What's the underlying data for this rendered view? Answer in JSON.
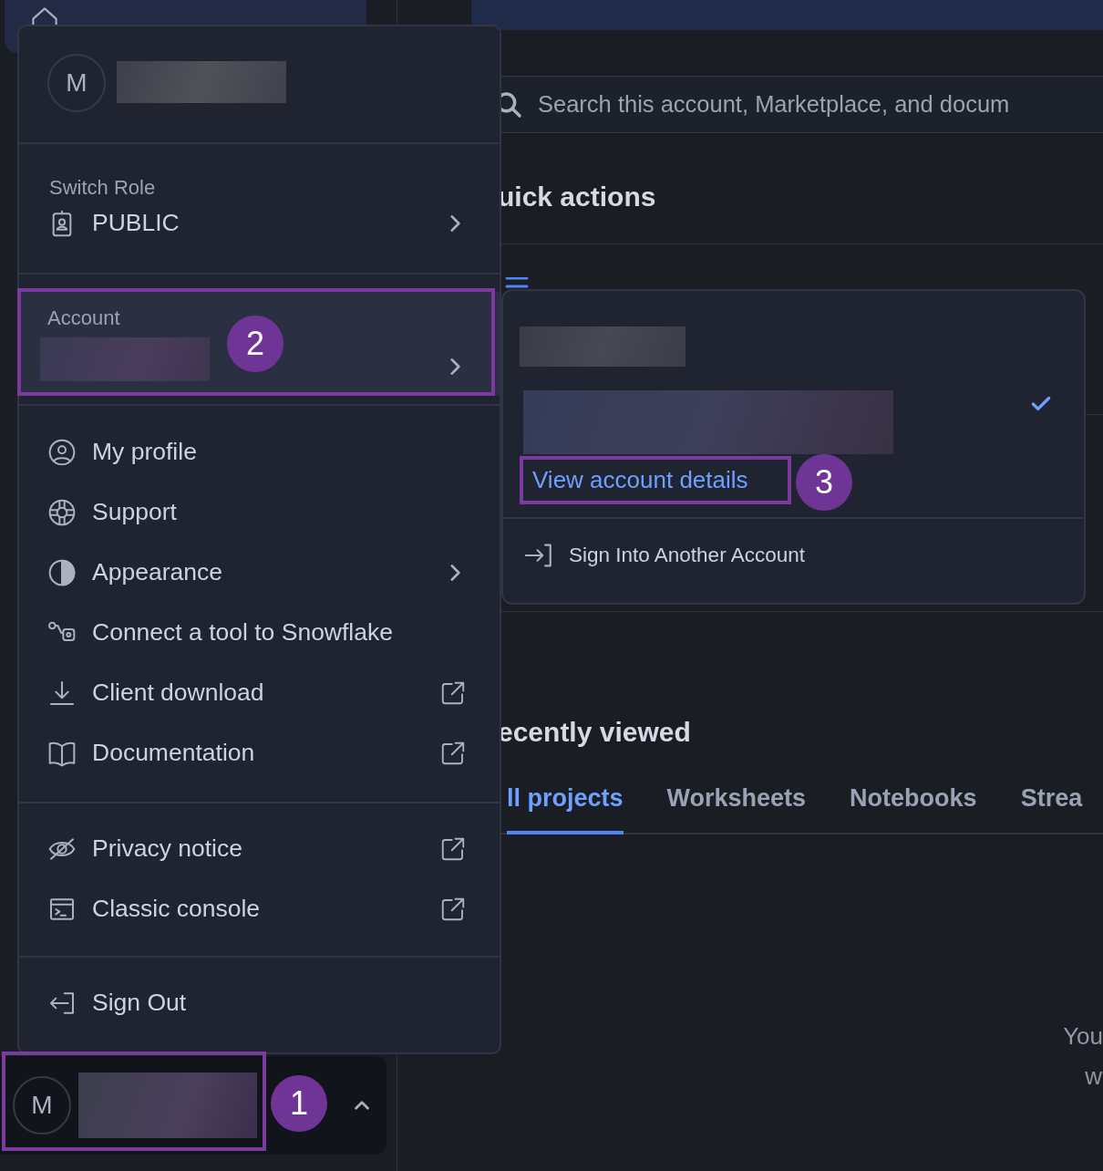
{
  "sidebar": {
    "home": {
      "selected": true
    },
    "user_button": {
      "avatar": "M",
      "expanded": true
    }
  },
  "search": {
    "placeholder": "Search this account, Marketplace, and docum"
  },
  "quick_actions": {
    "heading": "uick actions"
  },
  "recently_viewed": {
    "heading": "ecently viewed",
    "tabs": [
      {
        "label": "ll projects",
        "selected": true
      },
      {
        "label": "Worksheets",
        "selected": false
      },
      {
        "label": "Notebooks",
        "selected": false
      },
      {
        "label": "Strea",
        "selected": false
      }
    ],
    "empty_text": [
      "You",
      "w"
    ]
  },
  "user_menu": {
    "avatar": "M",
    "role": {
      "label": "Switch Role",
      "value": "PUBLIC"
    },
    "account": {
      "label": "Account",
      "selected": true
    },
    "groups": [
      [
        {
          "label": "My profile",
          "submenu": false,
          "external": false
        },
        {
          "label": "Support",
          "submenu": false,
          "external": false
        },
        {
          "label": "Appearance",
          "submenu": true,
          "external": false
        },
        {
          "label": "Connect a tool to Snowflake",
          "submenu": false,
          "external": false
        },
        {
          "label": "Client download",
          "submenu": false,
          "external": true
        },
        {
          "label": "Documentation",
          "submenu": false,
          "external": true
        }
      ],
      [
        {
          "label": "Privacy notice",
          "submenu": false,
          "external": true
        },
        {
          "label": "Classic console",
          "submenu": false,
          "external": true
        }
      ],
      [
        {
          "label": "Sign Out",
          "submenu": false,
          "external": false
        }
      ]
    ]
  },
  "account_menu": {
    "current_account": {
      "selected": true,
      "link": "View account details"
    },
    "sign_in_other": "Sign Into Another Account"
  },
  "annotations": [
    {
      "number": "1"
    },
    {
      "number": "2"
    },
    {
      "number": "3"
    }
  ]
}
